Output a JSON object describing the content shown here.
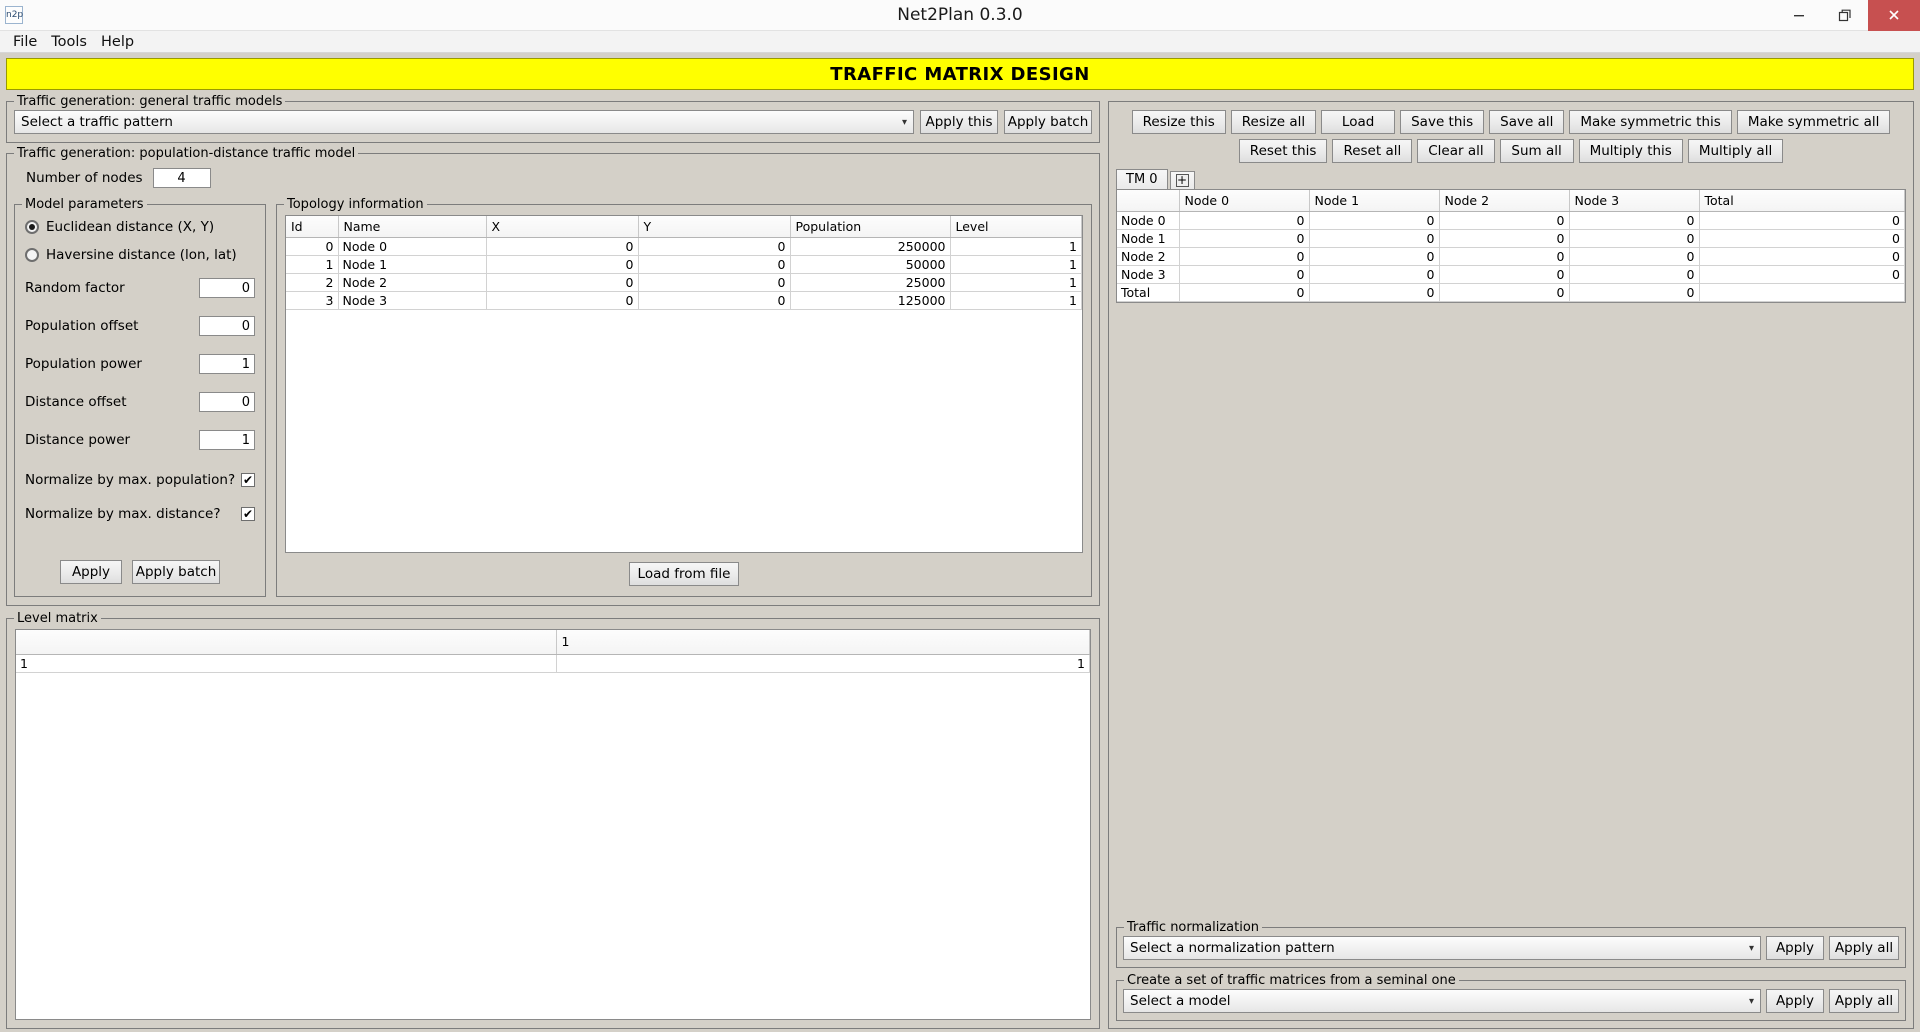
{
  "window": {
    "title": "Net2Plan 0.3.0",
    "app_icon_text": "n2p",
    "minimize": "minimize-icon",
    "maximize": "restore-icon",
    "close": "close-icon"
  },
  "menubar": {
    "items": [
      "File",
      "Tools",
      "Help"
    ]
  },
  "banner": {
    "text": "TRAFFIC MATRIX DESIGN"
  },
  "left": {
    "general_models": {
      "legend": "Traffic generation: general traffic models",
      "pattern_select": {
        "value": "Select a traffic pattern",
        "arrow": "▾"
      },
      "apply_this": "Apply this",
      "apply_batch": "Apply batch"
    },
    "popdist": {
      "legend": "Traffic generation: population-distance traffic model",
      "nodes_label": "Number of nodes",
      "nodes_value": "4",
      "model_params": {
        "legend": "Model parameters",
        "radio_euclidean": "Euclidean distance (X, Y)",
        "radio_haversine": "Haversine distance (lon, lat)",
        "euclidean_selected": true,
        "fields": [
          {
            "label": "Random factor",
            "value": "0"
          },
          {
            "label": "Population offset",
            "value": "0"
          },
          {
            "label": "Population power",
            "value": "1"
          },
          {
            "label": "Distance offset",
            "value": "0"
          },
          {
            "label": "Distance power",
            "value": "1"
          }
        ],
        "checks": [
          {
            "label": "Normalize by max. population?",
            "checked": true,
            "mark": "✔"
          },
          {
            "label": "Normalize by max. distance?",
            "checked": true,
            "mark": "✔"
          }
        ],
        "apply": "Apply",
        "apply_batch": "Apply batch"
      },
      "topology": {
        "legend": "Topology information",
        "columns": [
          "Id",
          "Name",
          "X",
          "Y",
          "Population",
          "Level"
        ],
        "rows": [
          [
            "0",
            "Node 0",
            "0",
            "0",
            "250000",
            "1"
          ],
          [
            "1",
            "Node 1",
            "0",
            "0",
            "50000",
            "1"
          ],
          [
            "2",
            "Node 2",
            "0",
            "0",
            "25000",
            "1"
          ],
          [
            "3",
            "Node 3",
            "0",
            "0",
            "125000",
            "1"
          ]
        ],
        "load_from_file": "Load from file"
      }
    },
    "level_matrix": {
      "legend": "Level matrix",
      "header": [
        "",
        "1"
      ],
      "rows": [
        [
          "1",
          "1"
        ]
      ]
    }
  },
  "right": {
    "toolbar_row1": [
      "Resize this",
      "Resize all",
      "Load",
      "Save this",
      "Save all",
      "Make symmetric this",
      "Make symmetric all"
    ],
    "toolbar_row2": [
      "Reset this",
      "Reset all",
      "Clear all",
      "Sum all",
      "Multiply this",
      "Multiply all"
    ],
    "tabs": {
      "active": "TM 0",
      "add": "+"
    },
    "matrix": {
      "columns": [
        "",
        "Node 0",
        "Node 1",
        "Node 2",
        "Node 3",
        "Total"
      ],
      "rows": [
        {
          "label": "Node 0",
          "values": [
            "0",
            "0",
            "0",
            "0",
            "0"
          ]
        },
        {
          "label": "Node 1",
          "values": [
            "0",
            "0",
            "0",
            "0",
            "0"
          ]
        },
        {
          "label": "Node 2",
          "values": [
            "0",
            "0",
            "0",
            "0",
            "0"
          ]
        },
        {
          "label": "Node 3",
          "values": [
            "0",
            "0",
            "0",
            "0",
            "0"
          ]
        },
        {
          "label": "Total",
          "values": [
            "0",
            "0",
            "0",
            "0",
            ""
          ]
        }
      ]
    },
    "normalization": {
      "legend": "Traffic normalization",
      "select": {
        "value": "Select a normalization pattern",
        "arrow": "▾"
      },
      "apply": "Apply",
      "apply_all": "Apply all"
    },
    "seminal": {
      "legend": "Create a set of traffic matrices from a seminal one",
      "select": {
        "value": "Select a model",
        "arrow": "▾"
      },
      "apply": "Apply",
      "apply_all": "Apply all"
    }
  }
}
